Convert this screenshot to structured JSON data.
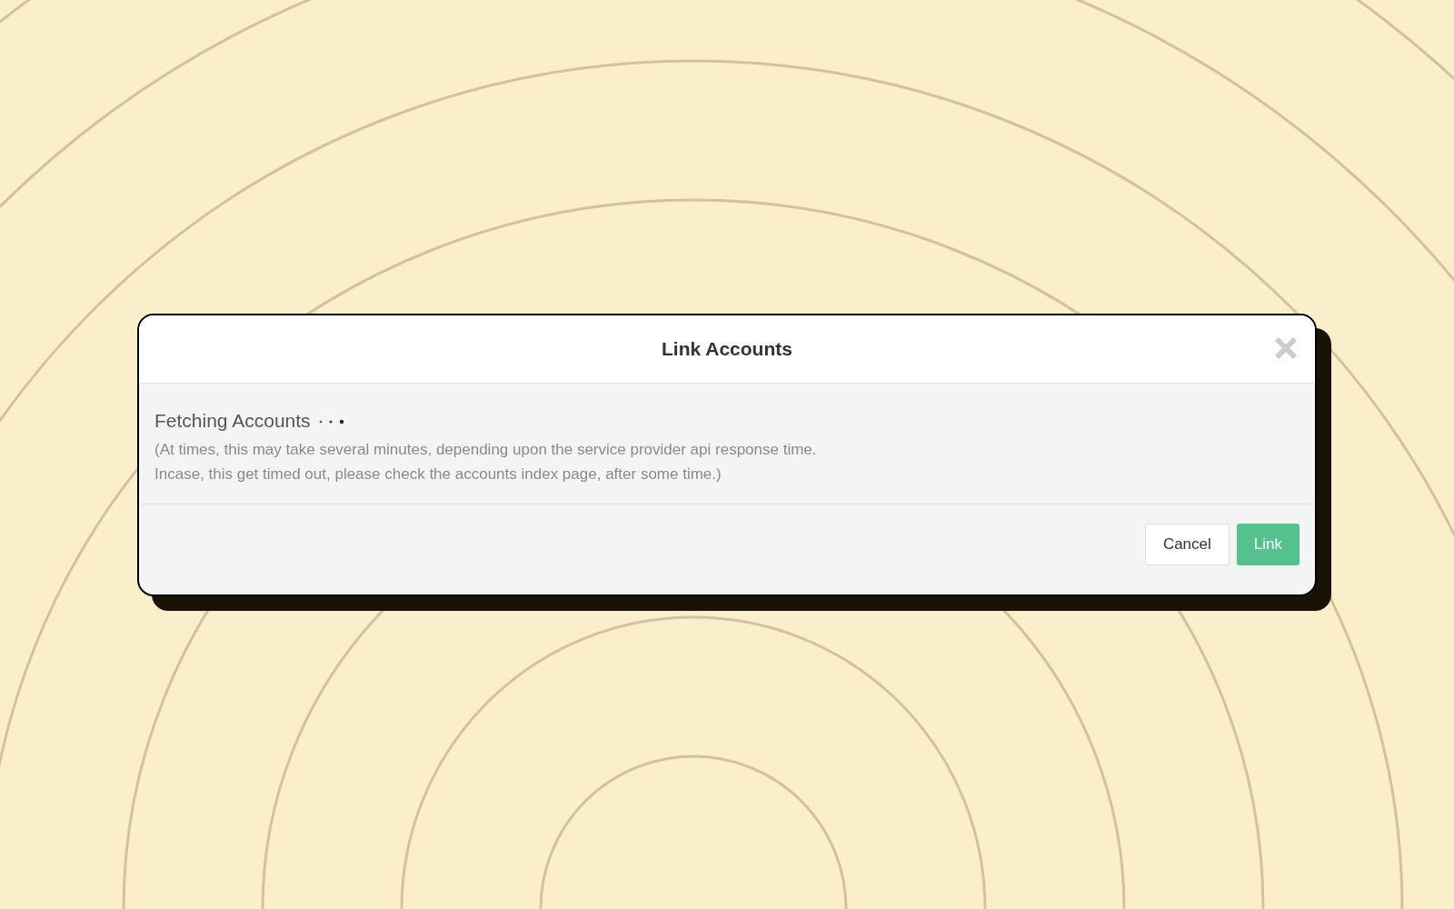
{
  "dialog": {
    "title": "Link Accounts",
    "status": "Fetching Accounts",
    "loading": true,
    "notes": [
      "(At times, this may take several minutes, depending upon the service provider api response time.",
      "Incase, this get timed out, please check the accounts index page, after some time.)"
    ],
    "buttons": [
      {
        "label": "Cancel",
        "kind": "secondary"
      },
      {
        "label": "Link",
        "kind": "primary"
      }
    ]
  }
}
